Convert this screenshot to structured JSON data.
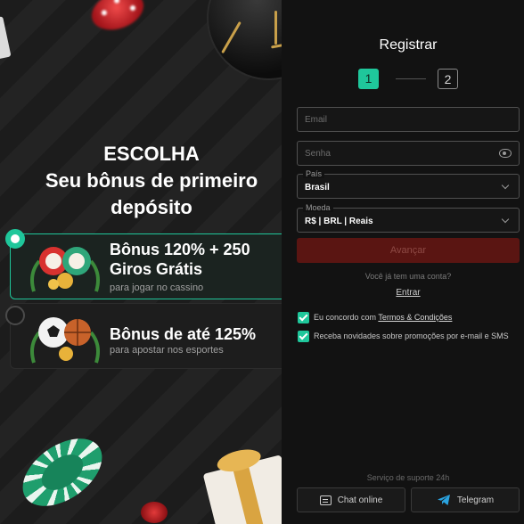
{
  "promo": {
    "headline_line1": "ESCOLHA",
    "headline_line2": "Seu bônus de primeiro",
    "headline_line3": "depósito",
    "bonuses": [
      {
        "title_line1": "Bônus 120% + 250",
        "title_line2": "Giros Grátis",
        "subtitle": "para jogar no cassino",
        "selected": true
      },
      {
        "title_line1": "Bônus de até 125%",
        "title_line2": "",
        "subtitle": "para apostar nos esportes",
        "selected": false
      }
    ]
  },
  "form": {
    "title": "Registrar",
    "steps": [
      "1",
      "2"
    ],
    "active_step": 1,
    "email_placeholder": "Email",
    "password_placeholder": "Senha",
    "country_label": "País",
    "country_value": "Brasil",
    "currency_label": "Moeda",
    "currency_value": "R$ | BRL | Reais",
    "advance_label": "Avançar",
    "have_account": "Você já tem uma conta?",
    "login_label": "Entrar",
    "terms_prefix": "Eu concordo com ",
    "terms_link": "Termos & Condições",
    "news_label": "Receba novidades sobre promoções por e-mail e SMS",
    "terms_checked": true,
    "news_checked": true
  },
  "support": {
    "label": "Serviço de suporte 24h",
    "chat_label": "Chat online",
    "telegram_label": "Telegram"
  },
  "colors": {
    "accent": "#1fc79b",
    "advance_disabled": "#5a1512",
    "telegram": "#2aa3e0"
  },
  "icons": [
    "eye-icon",
    "chevron-down-icon",
    "chat-icon",
    "telegram-icon",
    "check-icon",
    "radio-icon"
  ]
}
